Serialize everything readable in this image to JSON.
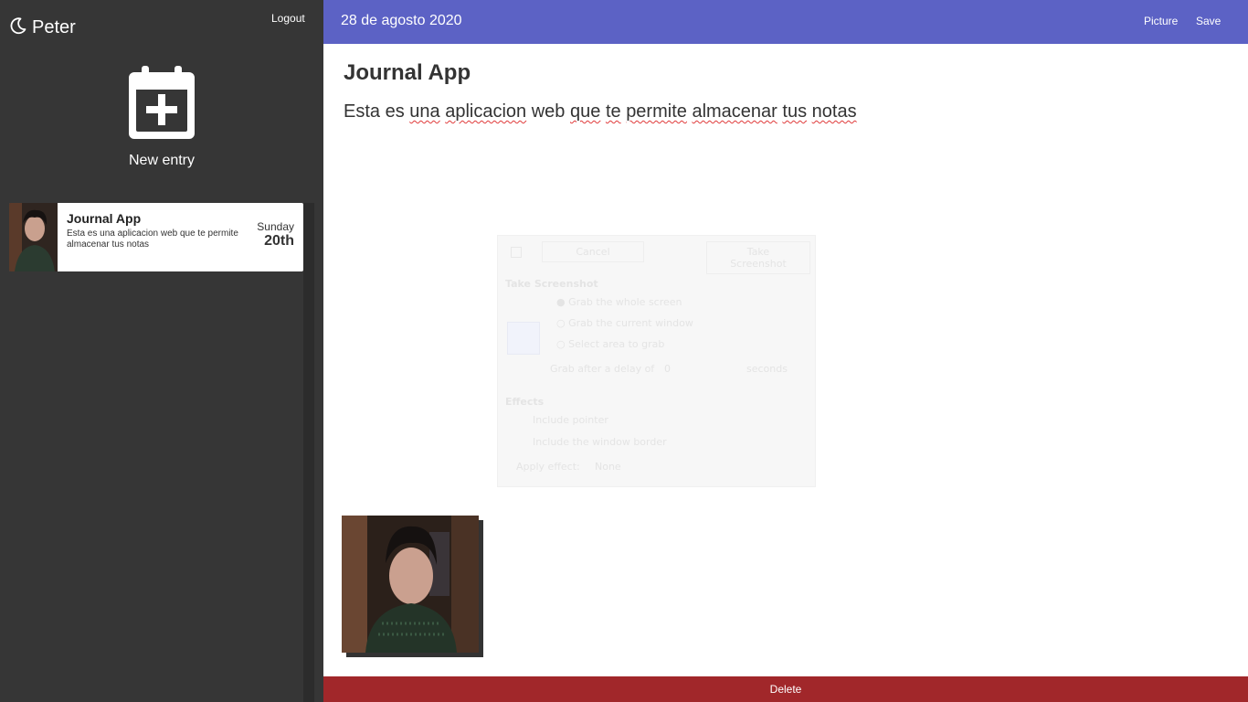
{
  "sidebar": {
    "brand": {
      "icon": "moon-icon",
      "name": "Peter"
    },
    "logout_label": "Logout",
    "new_entry": {
      "icon": "calendar-plus-icon",
      "label": "New entry"
    },
    "entries": [
      {
        "title": "Journal App",
        "text": "Esta es una aplicacion web que te permite almacenar tus notas",
        "day": "Sunday",
        "date": "20th"
      }
    ]
  },
  "topbar": {
    "date": "28 de agosto 2020",
    "picture_label": "Picture",
    "save_label": "Save",
    "color": "#5c62c5"
  },
  "note": {
    "title": "Journal App",
    "body_words": [
      "Esta",
      "es",
      "una",
      "aplicacion",
      "web",
      "que",
      "te",
      "permite",
      "almacenar",
      "tus",
      "notas"
    ]
  },
  "ghost_dialog": {
    "cancel": "Cancel",
    "take": "Take Screenshot",
    "heading": "Take Screenshot",
    "opt1": "Grab the whole screen",
    "opt2": "Grab the current window",
    "opt3": "Select area to grab",
    "delay_label": "Grab after a delay of",
    "delay_value": "0",
    "seconds": "seconds",
    "effects": "Effects",
    "pointer": "Include pointer",
    "border": "Include the window border",
    "apply_label": "Apply effect:",
    "apply_value": "None"
  },
  "footer": {
    "delete_label": "Delete",
    "color": "#a1272a"
  }
}
